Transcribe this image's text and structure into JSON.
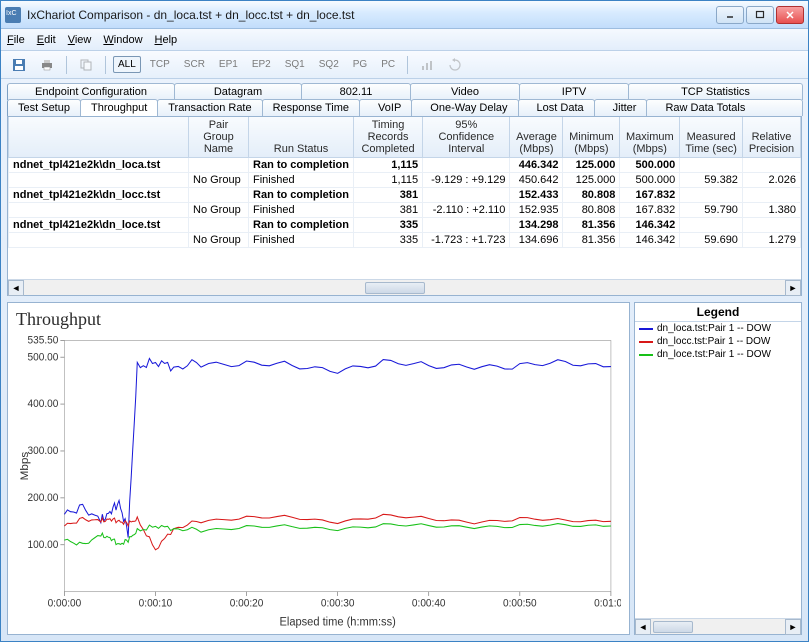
{
  "window": {
    "title": "IxChariot Comparison - dn_loca.tst + dn_locc.tst + dn_loce.tst"
  },
  "menu": {
    "file": "File",
    "edit": "Edit",
    "view": "View",
    "window": "Window",
    "help": "Help"
  },
  "toolbar": {
    "all": "ALL",
    "tcp": "TCP",
    "scr": "SCR",
    "ep1": "EP1",
    "ep2": "EP2",
    "sq1": "SQ1",
    "sq2": "SQ2",
    "pg": "PG",
    "pc": "PC"
  },
  "tabs_row1": [
    "Endpoint Configuration",
    "Datagram",
    "802.11",
    "Video",
    "IPTV",
    "TCP Statistics"
  ],
  "tabs_row2": [
    "Test Setup",
    "Throughput",
    "Transaction Rate",
    "Response Time",
    "VoIP",
    "One-Way Delay",
    "Lost Data",
    "Jitter",
    "Raw Data Totals"
  ],
  "grid": {
    "headers": [
      "",
      "Pair Group Name",
      "Run Status",
      "Timing Records Completed",
      "95% Confidence Interval",
      "Average (Mbps)",
      "Minimum (Mbps)",
      "Maximum (Mbps)",
      "Measured Time (sec)",
      "Relative Precision"
    ],
    "rows": [
      {
        "type": "hdr",
        "c0": "ndnet_tpl421e2k\\dn_loca.tst",
        "c2": "Ran to completion",
        "c3": "1,115",
        "c5": "446.342",
        "c6": "125.000",
        "c7": "500.000"
      },
      {
        "type": "row",
        "c1": "No Group",
        "c2": "Finished",
        "c3": "1,115",
        "c4": "-9.129 : +9.129",
        "c5": "450.642",
        "c6": "125.000",
        "c7": "500.000",
        "c8": "59.382",
        "c9": "2.026"
      },
      {
        "type": "hdr",
        "c0": "ndnet_tpl421e2k\\dn_locc.tst",
        "c2": "Ran to completion",
        "c3": "381",
        "c5": "152.433",
        "c6": "80.808",
        "c7": "167.832"
      },
      {
        "type": "row",
        "c1": "No Group",
        "c2": "Finished",
        "c3": "381",
        "c4": "-2.110 : +2.110",
        "c5": "152.935",
        "c6": "80.808",
        "c7": "167.832",
        "c8": "59.790",
        "c9": "1.380"
      },
      {
        "type": "hdr",
        "c0": "ndnet_tpl421e2k\\dn_loce.tst",
        "c2": "Ran to completion",
        "c3": "335",
        "c5": "134.298",
        "c6": "81.356",
        "c7": "146.342"
      },
      {
        "type": "row",
        "c1": "No Group",
        "c2": "Finished",
        "c3": "335",
        "c4": "-1.723 : +1.723",
        "c5": "134.696",
        "c6": "81.356",
        "c7": "146.342",
        "c8": "59.690",
        "c9": "1.279"
      }
    ]
  },
  "chart": {
    "title": "Throughput",
    "ylabel": "Mbps",
    "xlabel": "Elapsed time (h:mm:ss)",
    "yticks": [
      100.0,
      200.0,
      300.0,
      400.0,
      500.0,
      535.5
    ],
    "xticks": [
      "0:00:00",
      "0:00:10",
      "0:00:20",
      "0:00:30",
      "0:00:40",
      "0:00:50",
      "0:01:00"
    ]
  },
  "legend": {
    "title": "Legend",
    "items": [
      {
        "label": "dn_loca.tst:Pair 1 -- DOW",
        "color": "#1818d8"
      },
      {
        "label": "dn_locc.tst:Pair 1 -- DOW",
        "color": "#d81818"
      },
      {
        "label": "dn_loce.tst:Pair 1 -- DOW",
        "color": "#18c018"
      }
    ]
  },
  "chart_data": {
    "type": "line",
    "title": "Throughput",
    "xlabel": "Elapsed time (h:mm:ss)",
    "ylabel": "Mbps",
    "ylim": [
      0,
      535.5
    ],
    "xlim": [
      0,
      60
    ],
    "x": [
      0,
      2,
      4,
      5,
      6,
      7,
      8,
      10,
      12,
      15,
      20,
      25,
      30,
      35,
      40,
      45,
      50,
      55,
      60
    ],
    "series": [
      {
        "name": "dn_loca.tst:Pair 1 -- DOW",
        "color": "#1818d8",
        "values": [
          165,
          180,
          150,
          170,
          190,
          125,
          480,
          490,
          480,
          485,
          480,
          485,
          475,
          485,
          480,
          485,
          480,
          485,
          480
        ]
      },
      {
        "name": "dn_locc.tst:Pair 1 -- DOW",
        "color": "#d81818",
        "values": [
          140,
          155,
          150,
          155,
          150,
          145,
          155,
          90,
          135,
          150,
          155,
          160,
          150,
          160,
          155,
          150,
          155,
          150,
          150
        ]
      },
      {
        "name": "dn_loce.tst:Pair 1 -- DOW",
        "color": "#18c018",
        "values": [
          110,
          100,
          120,
          115,
          100,
          110,
          130,
          140,
          135,
          130,
          135,
          140,
          135,
          140,
          140,
          140,
          140,
          140,
          140
        ]
      }
    ]
  }
}
